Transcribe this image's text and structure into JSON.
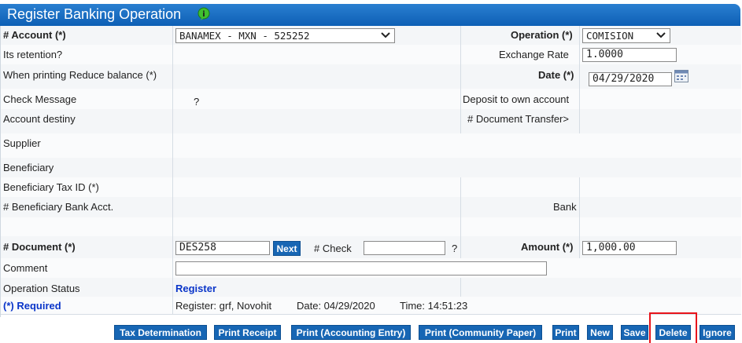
{
  "title": "Register Banking Operation",
  "fields": {
    "account_label": "# Account (*)",
    "account_value": "BANAMEX - MXN - 525252",
    "operation_label": "Operation (*)",
    "operation_value": "COMISION",
    "retention_label": "Its retention?",
    "exchange_rate_label": "Exchange Rate",
    "exchange_rate_value": "1.0000",
    "reduce_balance_label": "When printing Reduce balance (*)",
    "date_label": "Date (*)",
    "date_value": "04/29/2020",
    "check_message_label": "Check Message",
    "check_message_value": "?",
    "deposit_own_label": "Deposit to own account",
    "account_destiny_label": "Account destiny",
    "doc_transfer_label": "# Document Transfer>",
    "supplier_label": "Supplier",
    "beneficiary_label": "Beneficiary",
    "beneficiary_tax_label": "Beneficiary Tax ID (*)",
    "beneficiary_bank_acct_label": "# Beneficiary Bank Acct.",
    "bank_label": "Bank",
    "document_label": "# Document (*)",
    "document_value": "DES258",
    "next_label": "Next",
    "check_label": "# Check",
    "check_value": "",
    "check_q": "?",
    "amount_label": "Amount (*)",
    "amount_value": "1,000.00",
    "comment_label": "Comment",
    "comment_value": "",
    "status_label": "Operation Status",
    "status_value": "Register",
    "required_label": "(*) Required",
    "register_info": "Register: grf, Novohit",
    "date_info": "Date: 04/29/2020",
    "time_info": "Time: 14:51:23"
  },
  "buttons": {
    "tax_determination": "Tax Determination",
    "print_receipt": "Print Receipt",
    "print_accounting": "Print (Accounting Entry)",
    "print_community": "Print (Community Paper)",
    "print": "Print",
    "new": "New",
    "save": "Save",
    "delete": "Delete",
    "ignore": "Ignore"
  },
  "colors": {
    "title_bar": "#0d5fb5",
    "button": "#1766b4",
    "highlight": "#e8141b",
    "link": "#0a35c9"
  }
}
